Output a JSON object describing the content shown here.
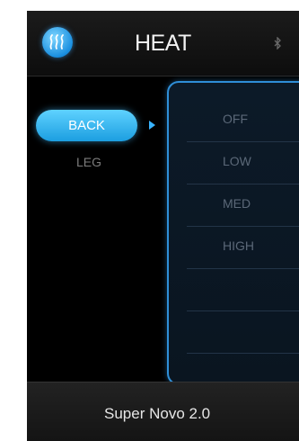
{
  "header": {
    "title": "HEAT",
    "app_icon": "heat-waves-icon",
    "status_icon": "bluetooth-icon"
  },
  "zones": [
    {
      "label": "BACK",
      "selected": true
    },
    {
      "label": "LEG",
      "selected": false
    }
  ],
  "levels": [
    "OFF",
    "LOW",
    "MED",
    "HIGH",
    "",
    "",
    ""
  ],
  "footer": {
    "device_name": "Super Novo 2.0"
  },
  "colors": {
    "accent": "#1c9ee0",
    "background": "#000000",
    "picker_border": "#2f8fd8"
  }
}
